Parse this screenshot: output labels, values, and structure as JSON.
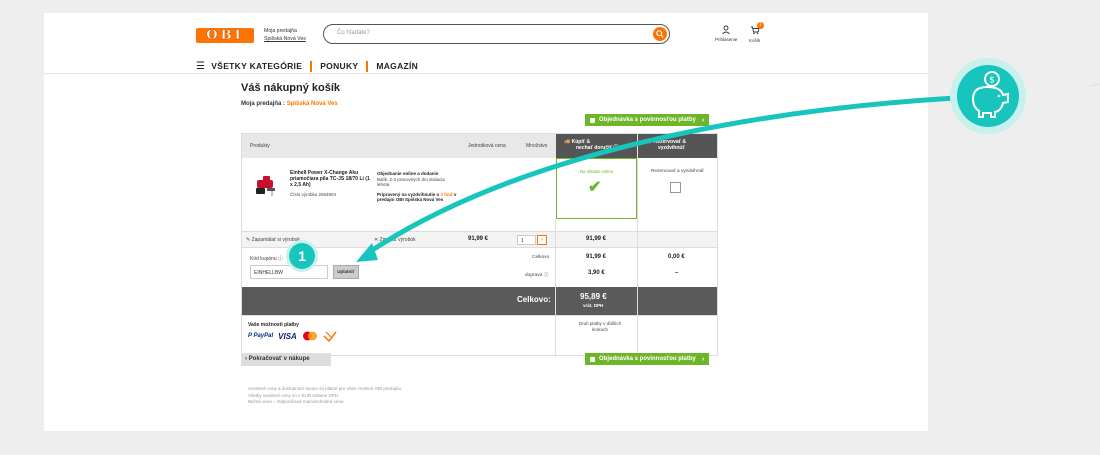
{
  "header": {
    "logo": "OBI",
    "store_label": "Moja predajňa",
    "store_name": "Spišská Nová Ves",
    "search_placeholder": "Čo hľadáte?",
    "login_label": "Prihlásenie",
    "cart_label": "Košík",
    "cart_count": "1"
  },
  "nav": {
    "items": [
      "VŠETKY KATEGÓRIE",
      "PONUKY",
      "MAGAZÍN"
    ]
  },
  "page": {
    "title": "Váš nákupný košík",
    "store_prefix": "Moja predajňa :",
    "store_name": "Spišská Nová Ves",
    "order_button": "Objednávka s povinnosťou platby",
    "continue_button": "Pokračovať v nákupe"
  },
  "table": {
    "headers": {
      "products": "Produkty",
      "unit_price": "Jednotková cena",
      "quantity": "Množstvo",
      "buy_col_line1": "Kúpiť &",
      "buy_col_line2": "nechať doručiť",
      "reserve_col_line1": "Rezervovať &",
      "reserve_col_line2": "vyzdvihnúť"
    },
    "item": {
      "name": "Einhell Power X-Change Aku priamočiara píla TC-JS 18/70 Li (1 x 2,5 Ah)",
      "number": "Číslo výrobku 2564904",
      "delivery_title": "Objednanie online a dodanie",
      "delivery_text": "Balík, 2-3 pracovných dní dodacia lehota",
      "pickup_prefix": "Pripravený na vyzdvihnutie o",
      "pickup_hours": "2 hod",
      "pickup_suffix": "v predajni OBI Spišská Nová Ves",
      "buy_status": "Na sklade online",
      "reserve_label": "Rezervovať a vyzdvihnúť",
      "unit_price": "91,99 €",
      "quantity": "1",
      "row_total": "91,99 €"
    },
    "actions": {
      "save": "Zapamätať si výrobok",
      "delete": "Zmazať výrobok"
    },
    "coupon": {
      "label": "Kód kupónu",
      "value": "EINHELLBW",
      "apply": "Uplatniť"
    },
    "summary": {
      "subtotal_label": "Celkovo",
      "subtotal_buy": "91,99 €",
      "subtotal_reserve": "0,00 €",
      "shipping_label": "doprava",
      "shipping_buy": "3,90 €",
      "shipping_reserve": "–",
      "total_label": "Celkovo:",
      "total_value": "95,89 €",
      "total_vat": "vrát. DPH"
    },
    "payment": {
      "title": "Vaše možnosti platby",
      "methods": [
        "PayPal",
        "VISA",
        "Mastercard",
        "Dobierka"
      ],
      "other_text": "Druh platby v ďalších krokoch"
    }
  },
  "footer": {
    "lines": [
      "Uvedené ceny a dostupnosť tovaru sú platné pre Vami zvolenú OBI predajňu",
      "Všetky uvedené ceny sú v EUR vrátane DPH",
      "Bežná cena = Odporúčaná maloobchodná cena"
    ]
  },
  "overlay": {
    "step_number": "1"
  },
  "colors": {
    "brand_orange": "#ff7300",
    "green": "#6eb52a",
    "teal": "#17c5bd",
    "dark_gray": "#555555"
  }
}
